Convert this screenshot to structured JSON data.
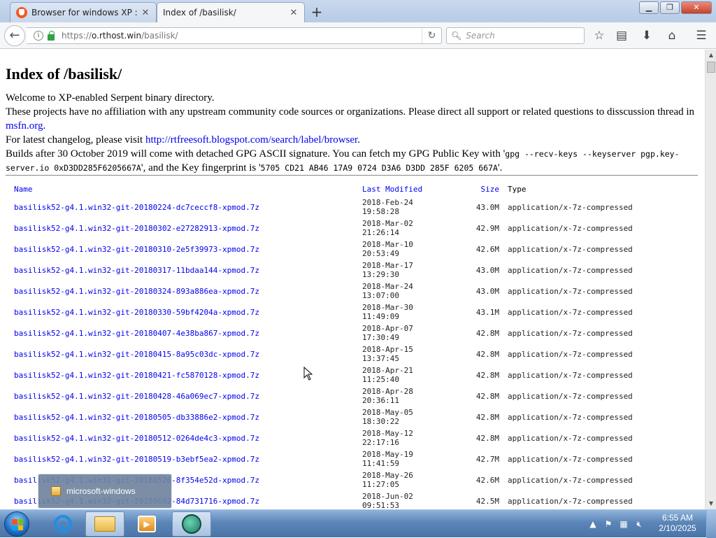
{
  "browser": {
    "tabs": [
      {
        "title": "Browser for windows XP : r/",
        "close": "✕"
      },
      {
        "title": "Index of /basilisk/",
        "close": "✕"
      }
    ],
    "new_tab": "+",
    "window_buttons": {
      "minimize": "▁",
      "maximize": "❐",
      "close": "✕"
    },
    "url_prefix": "https://",
    "url_host": "o.rthost.win",
    "url_path": "/basilisk/",
    "search_placeholder": "Search"
  },
  "page": {
    "heading": "Index of /basilisk/",
    "intro_line1": "Welcome to XP-enabled Serpent binary directory.",
    "intro_line2": "These projects have no affiliation with any upstream community code sources or organizations. Please direct all support or related questions to disscussion thread in",
    "intro_link_msfn": "msfn.org",
    "intro_line3": "For latest changelog, please visit",
    "intro_link_changelog": "http://rtfreesoft.blogspot.com/search/label/browser",
    "intro_line4": "Builds after 30 October 2019 will come with detached GPG ASCII signature. You can fetch my GPG Public Key with '",
    "gpg_cmd": "gpg --recv-keys --keyserver pgp.key-server.io 0xD3DD285F6205667A",
    "intro_line4b": "', and the Key fingerprint is '",
    "fingerprint": "5705 CD21 AB46 17A9 0724 D3A6 D3DD 285F 6205 667A",
    "intro_line4c": "'.",
    "table_headers": {
      "name": "Name",
      "modified": "Last Modified",
      "size": "Size",
      "type": "Type"
    },
    "files": [
      {
        "name": "basilisk52-g4.1.win32-git-20180224-dc7ceccf8-xpmod.7z",
        "date": "2018-Feb-24",
        "time": "19:58:28",
        "size": "43.0M",
        "type": "application/x-7z-compressed"
      },
      {
        "name": "basilisk52-g4.1.win32-git-20180302-e27282913-xpmod.7z",
        "date": "2018-Mar-02",
        "time": "21:26:14",
        "size": "42.9M",
        "type": "application/x-7z-compressed"
      },
      {
        "name": "basilisk52-g4.1.win32-git-20180310-2e5f39973-xpmod.7z",
        "date": "2018-Mar-10",
        "time": "20:53:49",
        "size": "42.6M",
        "type": "application/x-7z-compressed"
      },
      {
        "name": "basilisk52-g4.1.win32-git-20180317-11bdaa144-xpmod.7z",
        "date": "2018-Mar-17",
        "time": "13:29:30",
        "size": "43.0M",
        "type": "application/x-7z-compressed"
      },
      {
        "name": "basilisk52-g4.1.win32-git-20180324-893a886ea-xpmod.7z",
        "date": "2018-Mar-24",
        "time": "13:07:00",
        "size": "43.0M",
        "type": "application/x-7z-compressed"
      },
      {
        "name": "basilisk52-g4.1.win32-git-20180330-59bf4204a-xpmod.7z",
        "date": "2018-Mar-30",
        "time": "11:49:09",
        "size": "43.1M",
        "type": "application/x-7z-compressed"
      },
      {
        "name": "basilisk52-g4.1.win32-git-20180407-4e38ba867-xpmod.7z",
        "date": "2018-Apr-07",
        "time": "17:30:49",
        "size": "42.8M",
        "type": "application/x-7z-compressed"
      },
      {
        "name": "basilisk52-g4.1.win32-git-20180415-8a95c03dc-xpmod.7z",
        "date": "2018-Apr-15",
        "time": "13:37:45",
        "size": "42.8M",
        "type": "application/x-7z-compressed"
      },
      {
        "name": "basilisk52-g4.1.win32-git-20180421-fc5870128-xpmod.7z",
        "date": "2018-Apr-21",
        "time": "11:25:40",
        "size": "42.8M",
        "type": "application/x-7z-compressed"
      },
      {
        "name": "basilisk52-g4.1.win32-git-20180428-46a069ec7-xpmod.7z",
        "date": "2018-Apr-28",
        "time": "20:36:11",
        "size": "42.8M",
        "type": "application/x-7z-compressed"
      },
      {
        "name": "basilisk52-g4.1.win32-git-20180505-db33886e2-xpmod.7z",
        "date": "2018-May-05",
        "time": "18:30:22",
        "size": "42.8M",
        "type": "application/x-7z-compressed"
      },
      {
        "name": "basilisk52-g4.1.win32-git-20180512-0264de4c3-xpmod.7z",
        "date": "2018-May-12",
        "time": "22:17:16",
        "size": "42.8M",
        "type": "application/x-7z-compressed"
      },
      {
        "name": "basilisk52-g4.1.win32-git-20180519-b3ebf5ea2-xpmod.7z",
        "date": "2018-May-19",
        "time": "11:41:59",
        "size": "42.7M",
        "type": "application/x-7z-compressed"
      },
      {
        "name": "basilisk52-g4.1.win32-git-20180526-8f354e52d-xpmod.7z",
        "date": "2018-May-26",
        "time": "11:27:05",
        "size": "42.6M",
        "type": "application/x-7z-compressed"
      },
      {
        "name": "basilisk52-g4.1.win32-git-20180602-84d731716-xpmod.7z",
        "date": "2018-Jun-02",
        "time": "09:51:53",
        "size": "42.5M",
        "type": "application/x-7z-compressed"
      }
    ]
  },
  "taskbar": {
    "popup_label": "microsoft-windows",
    "clock_time": "6:55 AM",
    "clock_date": "2/10/2025"
  },
  "icons": [
    "back-arrow-icon",
    "info-icon",
    "lock-icon",
    "reload-icon",
    "search-icon",
    "bookmark-star-icon",
    "reading-list-icon",
    "download-icon",
    "home-icon",
    "menu-icon"
  ]
}
